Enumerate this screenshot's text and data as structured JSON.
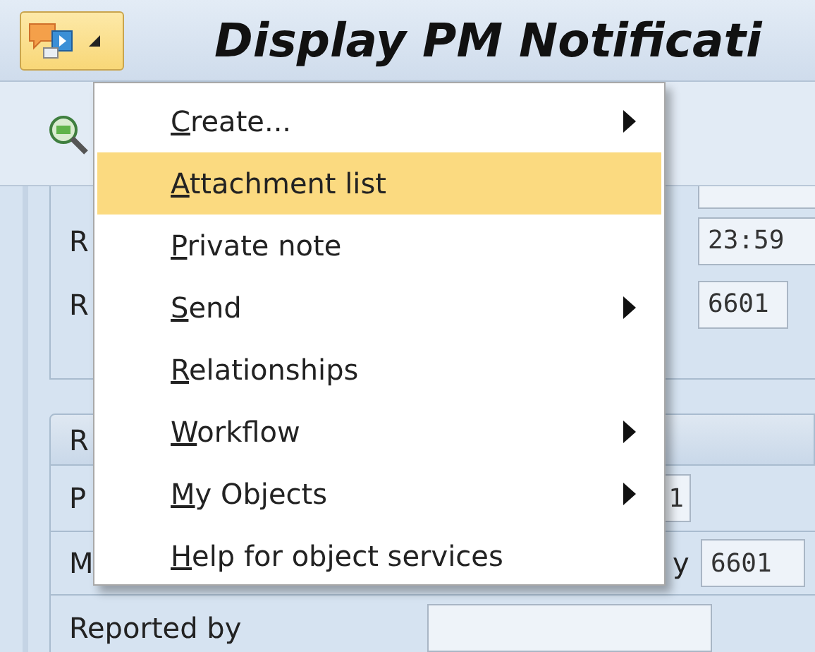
{
  "title_bar": {
    "title": "Display PM Notificati"
  },
  "services_menu": {
    "items": [
      {
        "label": "Create...",
        "submenu": true,
        "selected": false
      },
      {
        "label": "Attachment list",
        "submenu": false,
        "selected": true
      },
      {
        "label": "Private note",
        "submenu": false,
        "selected": false
      },
      {
        "label": "Send",
        "submenu": true,
        "selected": false
      },
      {
        "label": "Relationships",
        "submenu": false,
        "selected": false
      },
      {
        "label": "Workflow",
        "submenu": true,
        "selected": false
      },
      {
        "label": "My Objects",
        "submenu": true,
        "selected": false
      },
      {
        "label": "Help for object services",
        "submenu": false,
        "selected": false
      }
    ]
  },
  "group_1": {
    "rows": [
      {
        "label": "R",
        "value": "23:59"
      },
      {
        "label": "R",
        "value": "6601"
      }
    ]
  },
  "group_2": {
    "header": "R",
    "rows": [
      {
        "label": "P",
        "value": "1"
      },
      {
        "label": "M",
        "label_2": "y",
        "value": "6601"
      },
      {
        "label": "Reported by"
      }
    ]
  }
}
